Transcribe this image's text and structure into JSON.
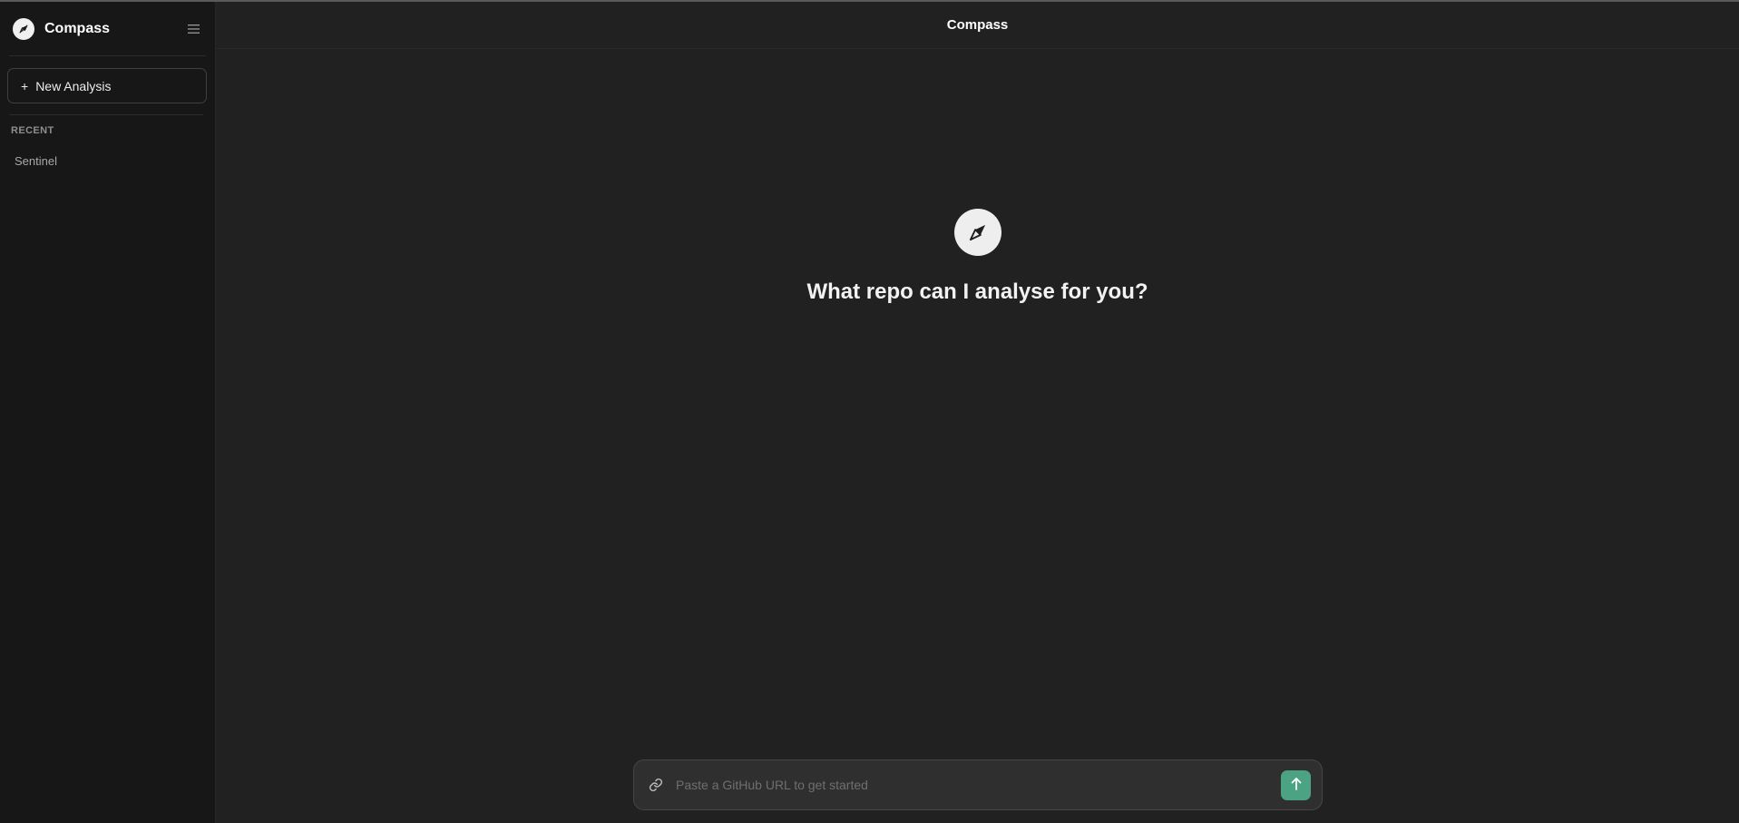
{
  "sidebar": {
    "brand": {
      "name": "Compass",
      "icon": "compass-icon"
    },
    "menu_icon": "menu-icon",
    "new_button": {
      "icon": "+",
      "label": "New Analysis"
    },
    "recent_label": "RECENT",
    "recent": [
      {
        "label": "Sentinel"
      }
    ]
  },
  "header": {
    "title": "Compass"
  },
  "hero": {
    "icon": "compass-icon",
    "title": "What repo can I analyse for you?"
  },
  "composer": {
    "icon": "link-icon",
    "value": "",
    "placeholder": "Paste a GitHub URL to get started",
    "send_icon": "arrow-up-icon"
  },
  "colors": {
    "accent": "#4ca383",
    "sidebar_bg": "#171717",
    "main_bg": "#212121",
    "input_bg": "#2f2f2f"
  }
}
